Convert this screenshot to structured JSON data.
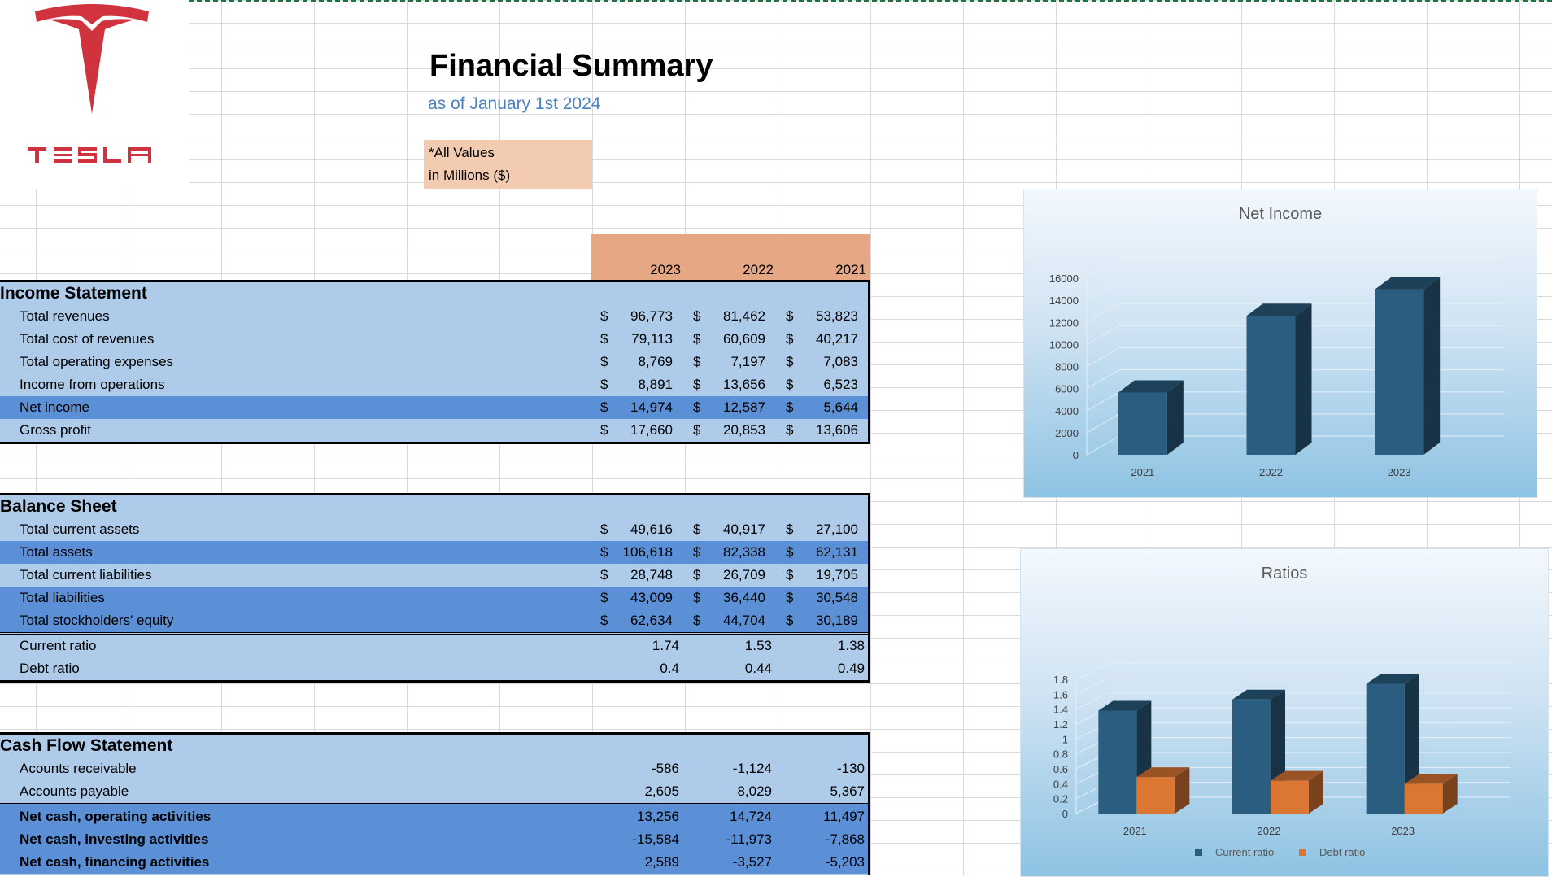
{
  "brand": {
    "name": "TESLA",
    "color": "#d0333d"
  },
  "header": {
    "title": "Financial Summary",
    "subtitle": "as of January 1st 2024",
    "note_line1": "*All Values",
    "note_line2": "in Millions ($)"
  },
  "years": [
    "2023",
    "2022",
    "2021"
  ],
  "income_statement": {
    "title": "Income Statement",
    "rows": [
      {
        "label": "Total revenues",
        "values": [
          "96,773",
          "81,462",
          "53,823"
        ]
      },
      {
        "label": "Total cost of revenues",
        "values": [
          "79,113",
          "60,609",
          "40,217"
        ]
      },
      {
        "label": "Total operating expenses",
        "values": [
          "8,769",
          "7,197",
          "7,083"
        ]
      },
      {
        "label": "Income from operations",
        "values": [
          "8,891",
          "13,656",
          "6,523"
        ]
      },
      {
        "label": "Net income",
        "values": [
          "14,974",
          "12,587",
          "5,644"
        ]
      },
      {
        "label": "Gross profit",
        "values": [
          "17,660",
          "20,853",
          "13,606"
        ]
      }
    ]
  },
  "balance_sheet": {
    "title": "Balance Sheet",
    "rows": [
      {
        "label": "Total current assets",
        "values": [
          "49,616",
          "40,917",
          "27,100"
        ]
      },
      {
        "label": "Total assets",
        "values": [
          "106,618",
          "82,338",
          "62,131"
        ]
      },
      {
        "label": "Total current liabilities",
        "values": [
          "28,748",
          "26,709",
          "19,705"
        ]
      },
      {
        "label": "Total liabilities",
        "values": [
          "43,009",
          "36,440",
          "30,548"
        ]
      },
      {
        "label": "Total stockholders' equity",
        "values": [
          "62,634",
          "44,704",
          "30,189"
        ]
      }
    ],
    "ratios": [
      {
        "label": "Current ratio",
        "values": [
          "1.74",
          "1.53",
          "1.38"
        ]
      },
      {
        "label": "Debt ratio",
        "values": [
          "0.4",
          "0.44",
          "0.49"
        ]
      }
    ]
  },
  "cash_flow": {
    "title": "Cash Flow Statement",
    "rows": [
      {
        "label": "Acounts receivable",
        "values": [
          "-586",
          "-1,124",
          "-130"
        ]
      },
      {
        "label": "Accounts payable",
        "values": [
          "2,605",
          "8,029",
          "5,367"
        ]
      }
    ],
    "net_rows": [
      {
        "label": "Net cash, operating activities",
        "values": [
          "13,256",
          "14,724",
          "11,497"
        ]
      },
      {
        "label": "Net cash, investing activities",
        "values": [
          "-15,584",
          "-11,973",
          "-7,868"
        ]
      },
      {
        "label": "Net cash, financing activities",
        "values": [
          "2,589",
          "-3,527",
          "-5,203"
        ]
      }
    ]
  },
  "currency": "$",
  "chart_data": [
    {
      "type": "bar",
      "title": "Net Income",
      "categories": [
        "2021",
        "2022",
        "2023"
      ],
      "series": [
        {
          "values": [
            5644,
            12587,
            14974
          ]
        }
      ],
      "ylim": [
        0,
        16000
      ],
      "yticks": [
        "0",
        "2000",
        "4000",
        "6000",
        "8000",
        "10000",
        "12000",
        "14000",
        "16000"
      ],
      "grid": true,
      "colors": [
        "#2b5d80"
      ]
    },
    {
      "type": "bar",
      "title": "Ratios",
      "categories": [
        "2021",
        "2022",
        "2023"
      ],
      "series": [
        {
          "name": "Current ratio",
          "values": [
            1.38,
            1.53,
            1.74
          ]
        },
        {
          "name": "Debt ratio",
          "values": [
            0.49,
            0.44,
            0.4
          ]
        }
      ],
      "ylim": [
        0,
        1.8
      ],
      "yticks": [
        "0",
        "0.2",
        "0.4",
        "0.6",
        "0.8",
        "1",
        "1.2",
        "1.4",
        "1.6",
        "1.8"
      ],
      "grid": true,
      "legend": "bottom",
      "colors": [
        "#2b5d80",
        "#dc7633"
      ]
    }
  ]
}
